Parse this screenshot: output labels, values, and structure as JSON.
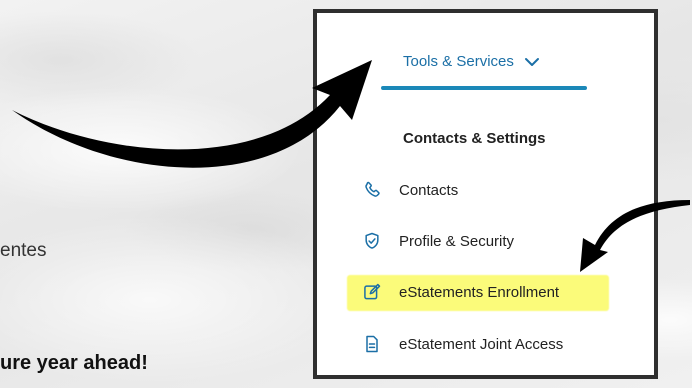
{
  "background": {
    "fragment_line_1": "entes",
    "fragment_line_2": "ure year ahead!"
  },
  "menu": {
    "tools_label": "Tools & Services",
    "section_title": "Contacts & Settings",
    "items": [
      {
        "label": "Contacts",
        "icon": "phone-icon"
      },
      {
        "label": "Profile & Security",
        "icon": "shield-check-icon"
      },
      {
        "label": "eStatements Enrollment",
        "icon": "edit-icon",
        "highlighted": true
      },
      {
        "label": "eStatement Joint Access",
        "icon": "document-icon"
      }
    ]
  },
  "colors": {
    "accent": "#1b88b8",
    "highlight": "#fbfb7a",
    "icon": "#1b6fa6"
  }
}
